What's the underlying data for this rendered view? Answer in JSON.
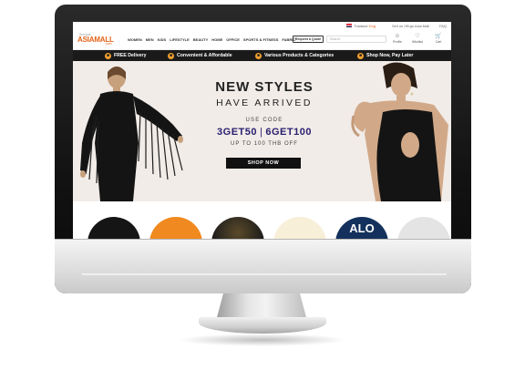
{
  "top_bar": {
    "language_thai": "Thailand",
    "language_eng": "Eng",
    "sell_link": "Sell on 2Ergo Asia Mall",
    "help_link": "FAQ"
  },
  "logo": {
    "small_text": "Sunsyst",
    "main_text": "ASIAMALL",
    "sub_text": ".com"
  },
  "nav": {
    "menu": [
      "WOMEN",
      "MEN",
      "KIDS",
      "LIFESTYLE",
      "BEAUTY",
      "HOME",
      "OFFICE",
      "SPORTS & FITNESS",
      "FABRIC"
    ],
    "quote_button": "Request a Quote",
    "search_placeholder": "Search",
    "profile_label": "Profile",
    "wishlist_label": "Wishlist",
    "cart_label": "Cart"
  },
  "promo_bar": {
    "items": [
      {
        "label": "FREE Delivery",
        "icon": "truck-icon"
      },
      {
        "label": "Convenient & Affordable",
        "icon": "wallet-icon"
      },
      {
        "label": "Various Products & Categories",
        "icon": "box-icon"
      },
      {
        "label": "Shop Now, Pay Later",
        "icon": "clock-icon"
      }
    ]
  },
  "hero": {
    "title": "NEW STYLES",
    "subtitle": "HAVE ARRIVED",
    "use_code": "USE CODE",
    "code_1": "3GET50",
    "code_separator": "|",
    "code_2": "6GET100",
    "discount": "UP TO 100 THB OFF",
    "cta": "SHOP NOW"
  },
  "categories": {
    "visible_text": "ALO"
  },
  "colors": {
    "accent": "#e5631a",
    "promo_bar": "#1a1a1a",
    "hero_bg": "#f1ece8",
    "code_color": "#2a2070",
    "promo_icon": "#f0a030"
  }
}
